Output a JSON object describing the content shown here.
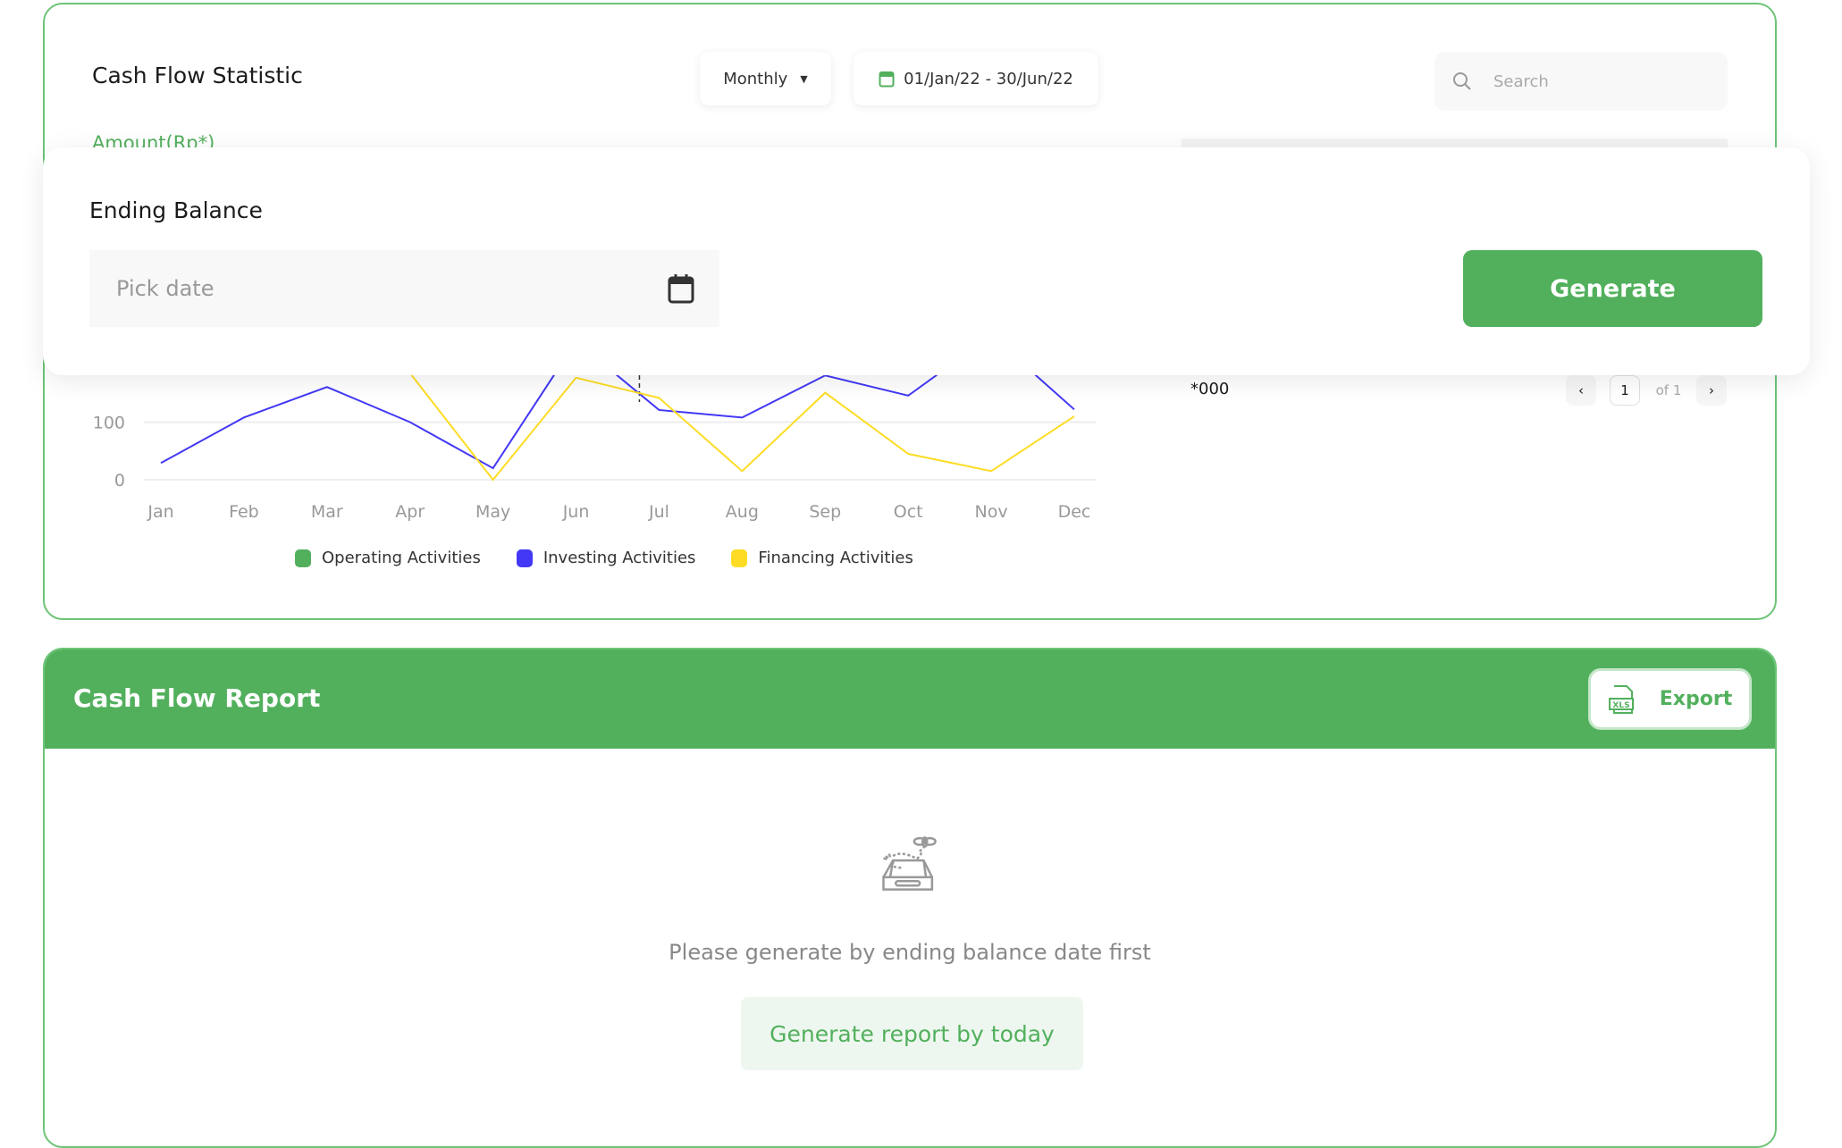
{
  "statistic": {
    "title": "Cash Flow Statistic",
    "period": "Monthly",
    "date_range": "01/Jan/22 - 30/Jun/22",
    "search_placeholder": "Search",
    "amount_label": "Amount(Rp*)",
    "unit": "*000",
    "pagination": {
      "prev": "‹",
      "page": "1",
      "of": "of 1",
      "next": "›"
    }
  },
  "ending_balance": {
    "title": "Ending Balance",
    "date_placeholder": "Pick date",
    "generate_label": "Generate"
  },
  "chart_data": {
    "type": "line",
    "categories": [
      "Jan",
      "Feb",
      "Mar",
      "Apr",
      "May",
      "Jun",
      "Jul",
      "Aug",
      "Sep",
      "Oct",
      "Nov",
      "Dec"
    ],
    "y_ticks": [
      "0",
      "100"
    ],
    "ylim": [
      0,
      300
    ],
    "grid": true,
    "legend_position": "bottom",
    "series": [
      {
        "name": "Operating Activities",
        "color": "#52b05d",
        "values": []
      },
      {
        "name": "Investing Activities",
        "color": "#4338f5",
        "values": [
          29,
          108,
          161,
          100,
          20,
          240,
          121,
          108,
          181,
          146,
          250,
          122
        ]
      },
      {
        "name": "Financing Activities",
        "color": "#fddc23",
        "values": [
          260,
          240,
          220,
          185,
          0,
          177,
          142,
          15,
          151,
          45,
          15,
          110
        ]
      }
    ]
  },
  "report": {
    "title": "Cash Flow Report",
    "export_label": "Export",
    "empty_message": "Please generate by ending balance date first",
    "generate_today_label": "Generate report by today"
  }
}
